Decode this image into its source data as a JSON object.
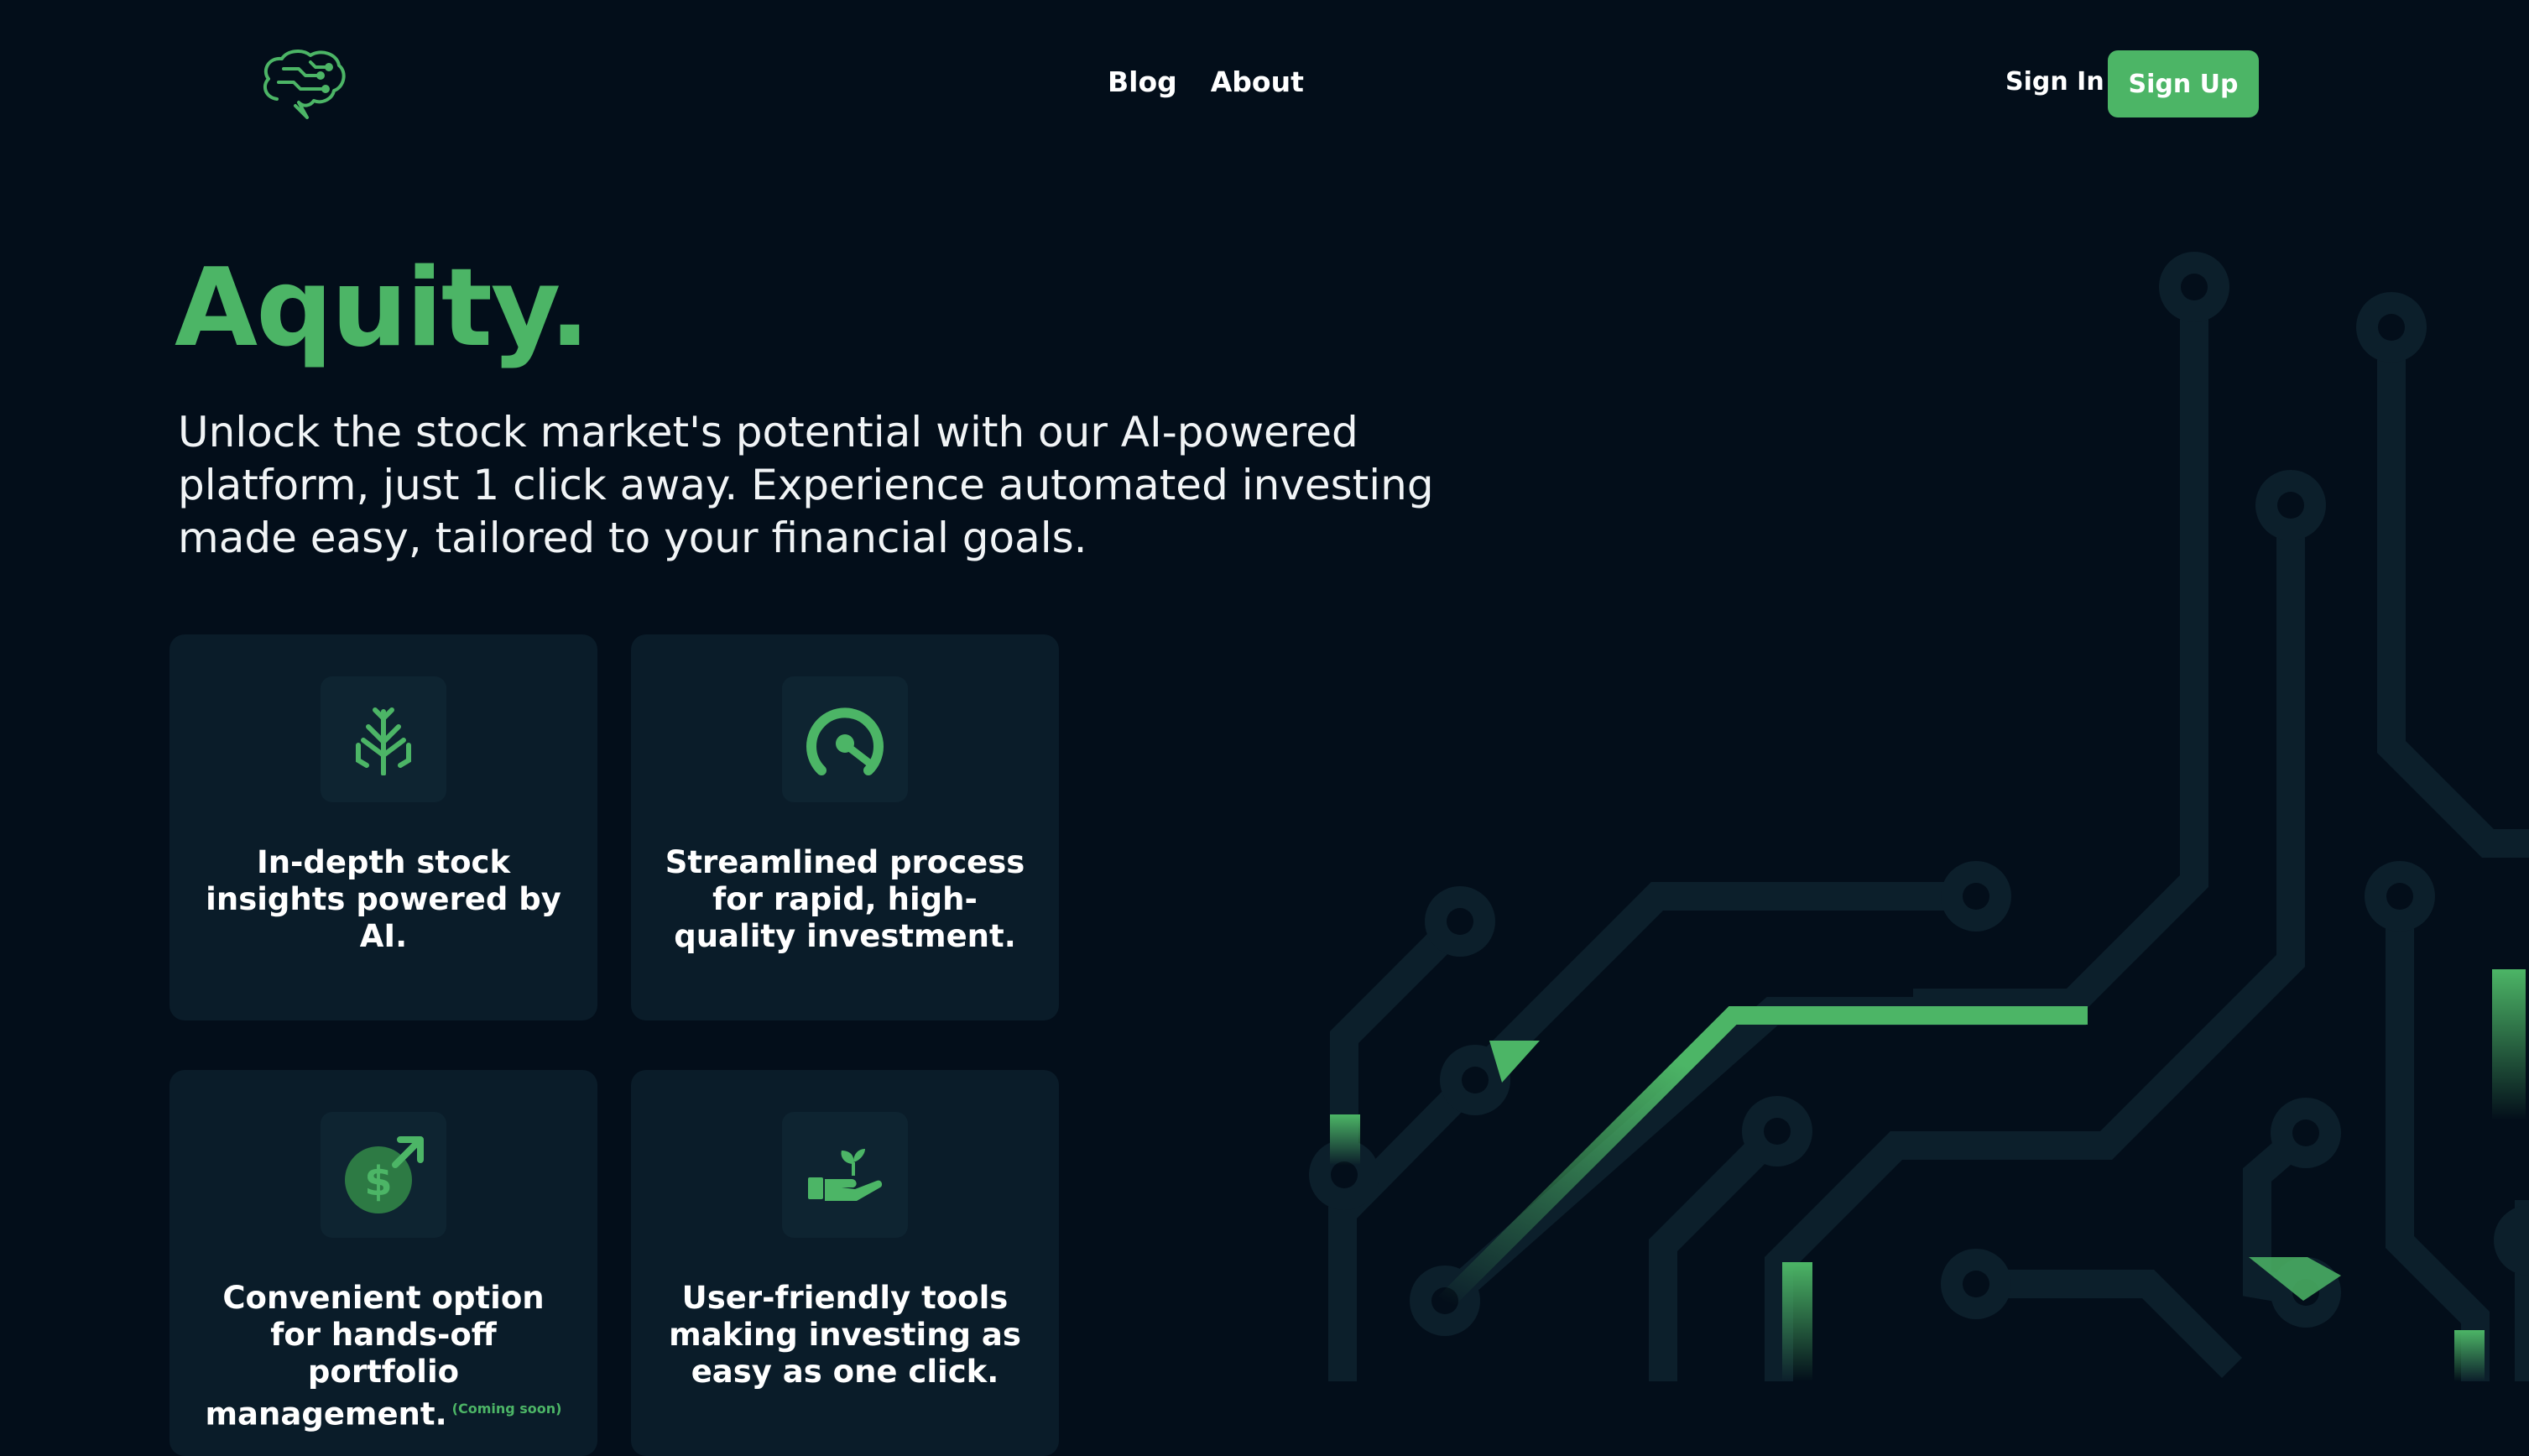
{
  "nav": {
    "links": [
      "Blog",
      "About"
    ],
    "sign_in": "Sign In",
    "sign_up": "Sign Up"
  },
  "hero": {
    "title": "Aquity.",
    "subtitle": "Unlock the stock market's potential with our AI-powered platform, just 1 click away. Experience automated investing made easy, tailored to your financial goals."
  },
  "features": [
    {
      "icon": "tree-icon",
      "text": "In-depth stock insights powered by AI."
    },
    {
      "icon": "speedometer-icon",
      "text": "Streamlined process for rapid, high-quality investment."
    },
    {
      "icon": "dollar-growth-icon",
      "text": "Convenient option for hands-off portfolio management.",
      "badge": "(Coming soon)"
    },
    {
      "icon": "hand-sprout-icon",
      "text": "User-friendly tools making investing as easy as one click."
    }
  ],
  "colors": {
    "background": "#030e1a",
    "accent": "#4cb566",
    "card": "#0a1c29",
    "circuit": "#0c1f2b"
  }
}
